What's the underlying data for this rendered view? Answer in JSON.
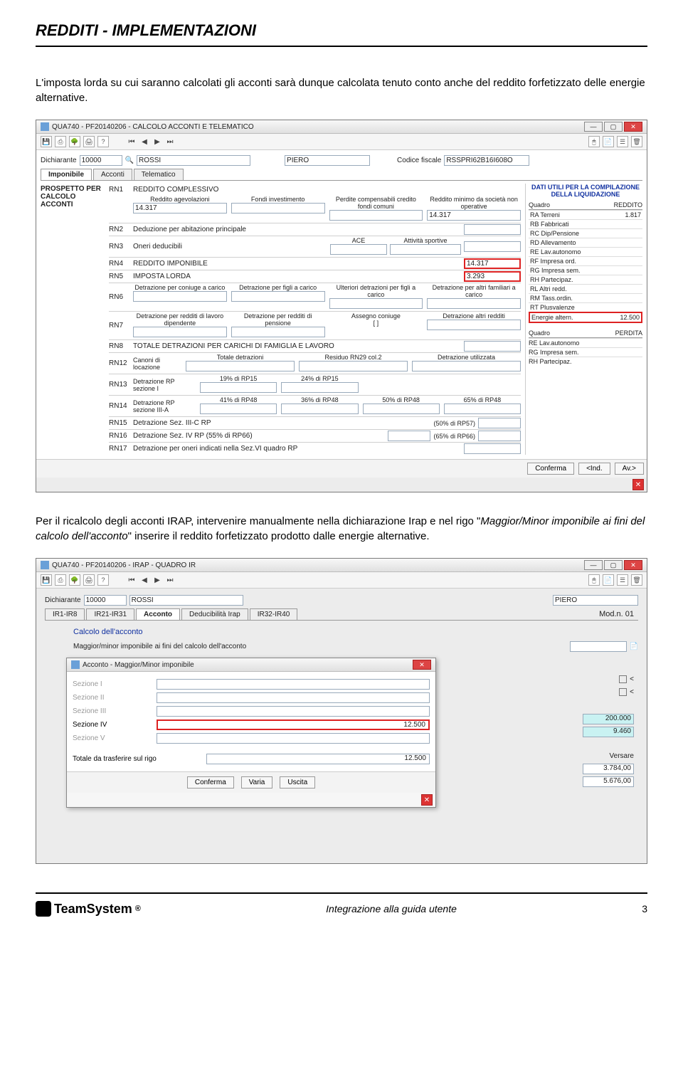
{
  "header": "REDDITI - IMPLEMENTAZIONI",
  "para1": "L'imposta lorda su cui saranno calcolati gli acconti sarà dunque calcolata tenuto conto anche del reddito forfetizzato delle energie alternative.",
  "para2a": "Per il ricalcolo degli acconti IRAP, intervenire manualmente nella dichiarazione Irap e nel rigo \"",
  "para2b": "Maggior/Minor imponibile ai fini del calcolo dell'acconto",
  "para2c": "\" inserire il reddito forfetizzato prodotto dalle energie alternative.",
  "win1": {
    "title": "QUA740 - PF20140206 - CALCOLO ACCONTI E TELEMATICO",
    "dich_label": "Dichiarante",
    "dich_code": "10000",
    "dich_cognome": "ROSSI",
    "dich_nome": "PIERO",
    "cf_label": "Codice fiscale",
    "cf_value": "RSSPRI62B16I608O",
    "tabs": [
      "Imponibile",
      "Acconti",
      "Telematico"
    ],
    "prospetto": "PROSPETTO PER CALCOLO ACCONTI",
    "rn1": {
      "code": "RN1",
      "title": "REDDITO COMPLESSIVO",
      "sub": [
        "Reddito agevolazioni",
        "Fondi investimento",
        "Perdite compensabili credito fondi comuni",
        "Reddito minimo da società non operative"
      ],
      "val_agev": "14.317",
      "val_min": "14.317"
    },
    "rn2": {
      "code": "RN2",
      "title": "Deduzione per abitazione principale"
    },
    "rn3": {
      "code": "RN3",
      "title": "Oneri deducibili",
      "sub": [
        "ACE",
        "Attività sportive"
      ]
    },
    "rn4": {
      "code": "RN4",
      "title": "REDDITO IMPONIBILE",
      "val": "14.317"
    },
    "rn5": {
      "code": "RN5",
      "title": "IMPOSTA LORDA",
      "val": "3.293"
    },
    "rn6": {
      "code": "RN6",
      "sub": [
        "Detrazione per coniuge a carico",
        "Detrazione per figli a carico",
        "Ulteriori detrazioni per figli a carico",
        "Detrazione per altri familiari a carico"
      ]
    },
    "rn7": {
      "code": "RN7",
      "sub": [
        "Detrazione per redditi di lavoro dipendente",
        "Detrazione per redditi di pensione",
        "Assegno coniuge",
        "Detrazione altri redditi"
      ],
      "bracket": "[        ]"
    },
    "rn8": {
      "code": "RN8",
      "title": "TOTALE DETRAZIONI PER CARICHI DI FAMIGLIA E LAVORO"
    },
    "rn12": {
      "code": "RN12",
      "title": "Canoni di locazione",
      "sub": [
        "Totale detrazioni",
        "Residuo RN29 col.2",
        "Detrazione utilizzata"
      ]
    },
    "rn13": {
      "code": "RN13",
      "title": "Detrazione RP sezione I",
      "sub": [
        "19% di RP15",
        "24% di RP15"
      ]
    },
    "rn14": {
      "code": "RN14",
      "title": "Detrazione RP sezione III-A",
      "sub": [
        "41% di RP48",
        "36% di RP48",
        "50% di RP48",
        "65% di RP48"
      ]
    },
    "rn15": {
      "code": "RN15",
      "title": "Detrazione Sez. III-C RP",
      "extra": "(50% di RP57)"
    },
    "rn16": {
      "code": "RN16",
      "title": "Detrazione Sez. IV RP   (55% di RP66)",
      "extra": "(65% di RP66)"
    },
    "rn17": {
      "code": "RN17",
      "title": "Detrazione per oneri indicati nella Sez.VI quadro RP"
    },
    "dati_title": "DATI UTILI PER LA COMPILAZIONE DELLA LIQUIDAZIONE",
    "dati_head": [
      "Quadro",
      "REDDITO"
    ],
    "dati_rows": [
      {
        "q": "RA Terreni",
        "v": "1.817"
      },
      {
        "q": "RB Fabbricati",
        "v": ""
      },
      {
        "q": "RC Dip/Pensione",
        "v": ""
      },
      {
        "q": "RD Allevamento",
        "v": ""
      },
      {
        "q": "RE Lav.autonomo",
        "v": ""
      },
      {
        "q": "RF Impresa ord.",
        "v": ""
      },
      {
        "q": "RG Impresa sem.",
        "v": ""
      },
      {
        "q": "RH Partecipaz.",
        "v": ""
      },
      {
        "q": "RL Altri redd.",
        "v": ""
      },
      {
        "q": "RM Tass.ordin.",
        "v": ""
      },
      {
        "q": "RT Plusvalenze",
        "v": ""
      },
      {
        "q": "Energie altern.",
        "v": "12.500"
      }
    ],
    "dati_head2": [
      "Quadro",
      "PERDITA"
    ],
    "dati_rows2": [
      {
        "q": "RE Lav.autonomo",
        "v": ""
      },
      {
        "q": "RG Impresa sem.",
        "v": ""
      },
      {
        "q": "RH Partecipaz.",
        "v": ""
      }
    ],
    "conferma": "Conferma",
    "ind": "<Ind.",
    "av": "Av.>"
  },
  "win2": {
    "title": "QUA740 - PF20140206 - IRAP - QUADRO IR",
    "dich_label": "Dichiarante",
    "dich_code": "10000",
    "dich_cognome": "ROSSI",
    "dich_nome": "PIERO",
    "tabs": [
      "IR1-IR8",
      "IR21-IR31",
      "Acconto",
      "Deducibilità Irap",
      "IR32-IR40"
    ],
    "mod": "Mod.n. 01",
    "calc_title": "Calcolo dell'acconto",
    "maggior_label": "Maggior/minor imponibile ai fini del calcolo dell'acconto",
    "modal_title": "Acconto - Maggior/Minor imponibile",
    "sez": [
      "Sezione I",
      "Sezione II",
      "Sezione III",
      "Sezione IV",
      "Sezione V"
    ],
    "sez4_val": "12.500",
    "tot_label": "Totale da trasferire sul rigo",
    "tot_val": "12.500",
    "btns": [
      "Conferma",
      "Varia",
      "Uscita"
    ],
    "side": {
      "a": "200.000",
      "b": "9.460",
      "versare": "Versare",
      "c": "3.784,00",
      "d": "5.676,00"
    }
  },
  "footer": {
    "brand": "TeamSystem",
    "center": "Integrazione alla guida utente",
    "page": "3"
  }
}
